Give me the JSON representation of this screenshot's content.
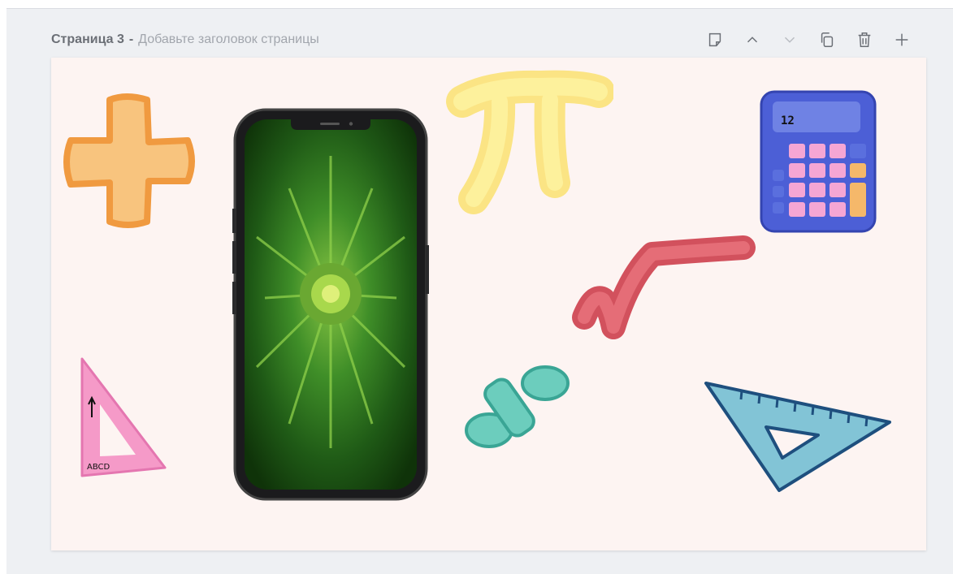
{
  "page": {
    "number_label": "Страница 3",
    "separator": "-",
    "title_placeholder": "Добавьте заголовок страницы"
  },
  "toolbar": {
    "buttons": [
      "note-icon",
      "chevron-up-icon",
      "chevron-down-icon",
      "duplicate-icon",
      "trash-icon",
      "plus-icon"
    ]
  },
  "canvas": {
    "background": "#fdf4f2",
    "calculator_display": "12",
    "triangle_ruler_text": "ABCD"
  },
  "colors": {
    "plus": "#f8c47e",
    "pi": "#fbe484",
    "calculator": "#4c5fd6",
    "sqrt": "#e0646e",
    "division": "#6ccdbd",
    "set_square_pink": "#f59ac8",
    "set_square_blue": "#82c4d6"
  }
}
